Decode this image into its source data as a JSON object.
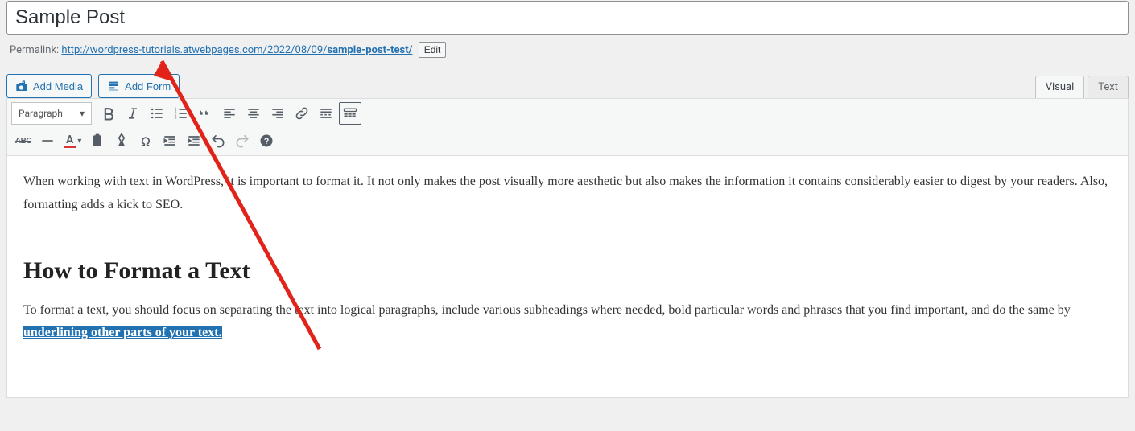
{
  "title": "Sample Post",
  "permalink": {
    "label": "Permalink:",
    "base": "http://wordpress-tutorials.atwebpages.com/2022/08/09/",
    "slug": "sample-post-test/",
    "edit_label": "Edit"
  },
  "buttons": {
    "add_media": "Add Media",
    "add_form": "Add Form"
  },
  "tabs": {
    "visual": "Visual",
    "text": "Text"
  },
  "toolbar": {
    "format_label": "Paragraph"
  },
  "content": {
    "p1": "When working with text in WordPress, it is important to format it. It not only makes the post visually more aesthetic but also makes the information it contains considerably easier to digest by your readers. Also, formatting adds a kick to SEO.",
    "h2": "How to Format a Text",
    "p2_before": "To format a text, you should focus on separating the text into logical paragraphs, include various subheadings where needed, bold particular words and phrases that you find important, and do the same by ",
    "p2_selected": "underlining other parts of your text."
  }
}
